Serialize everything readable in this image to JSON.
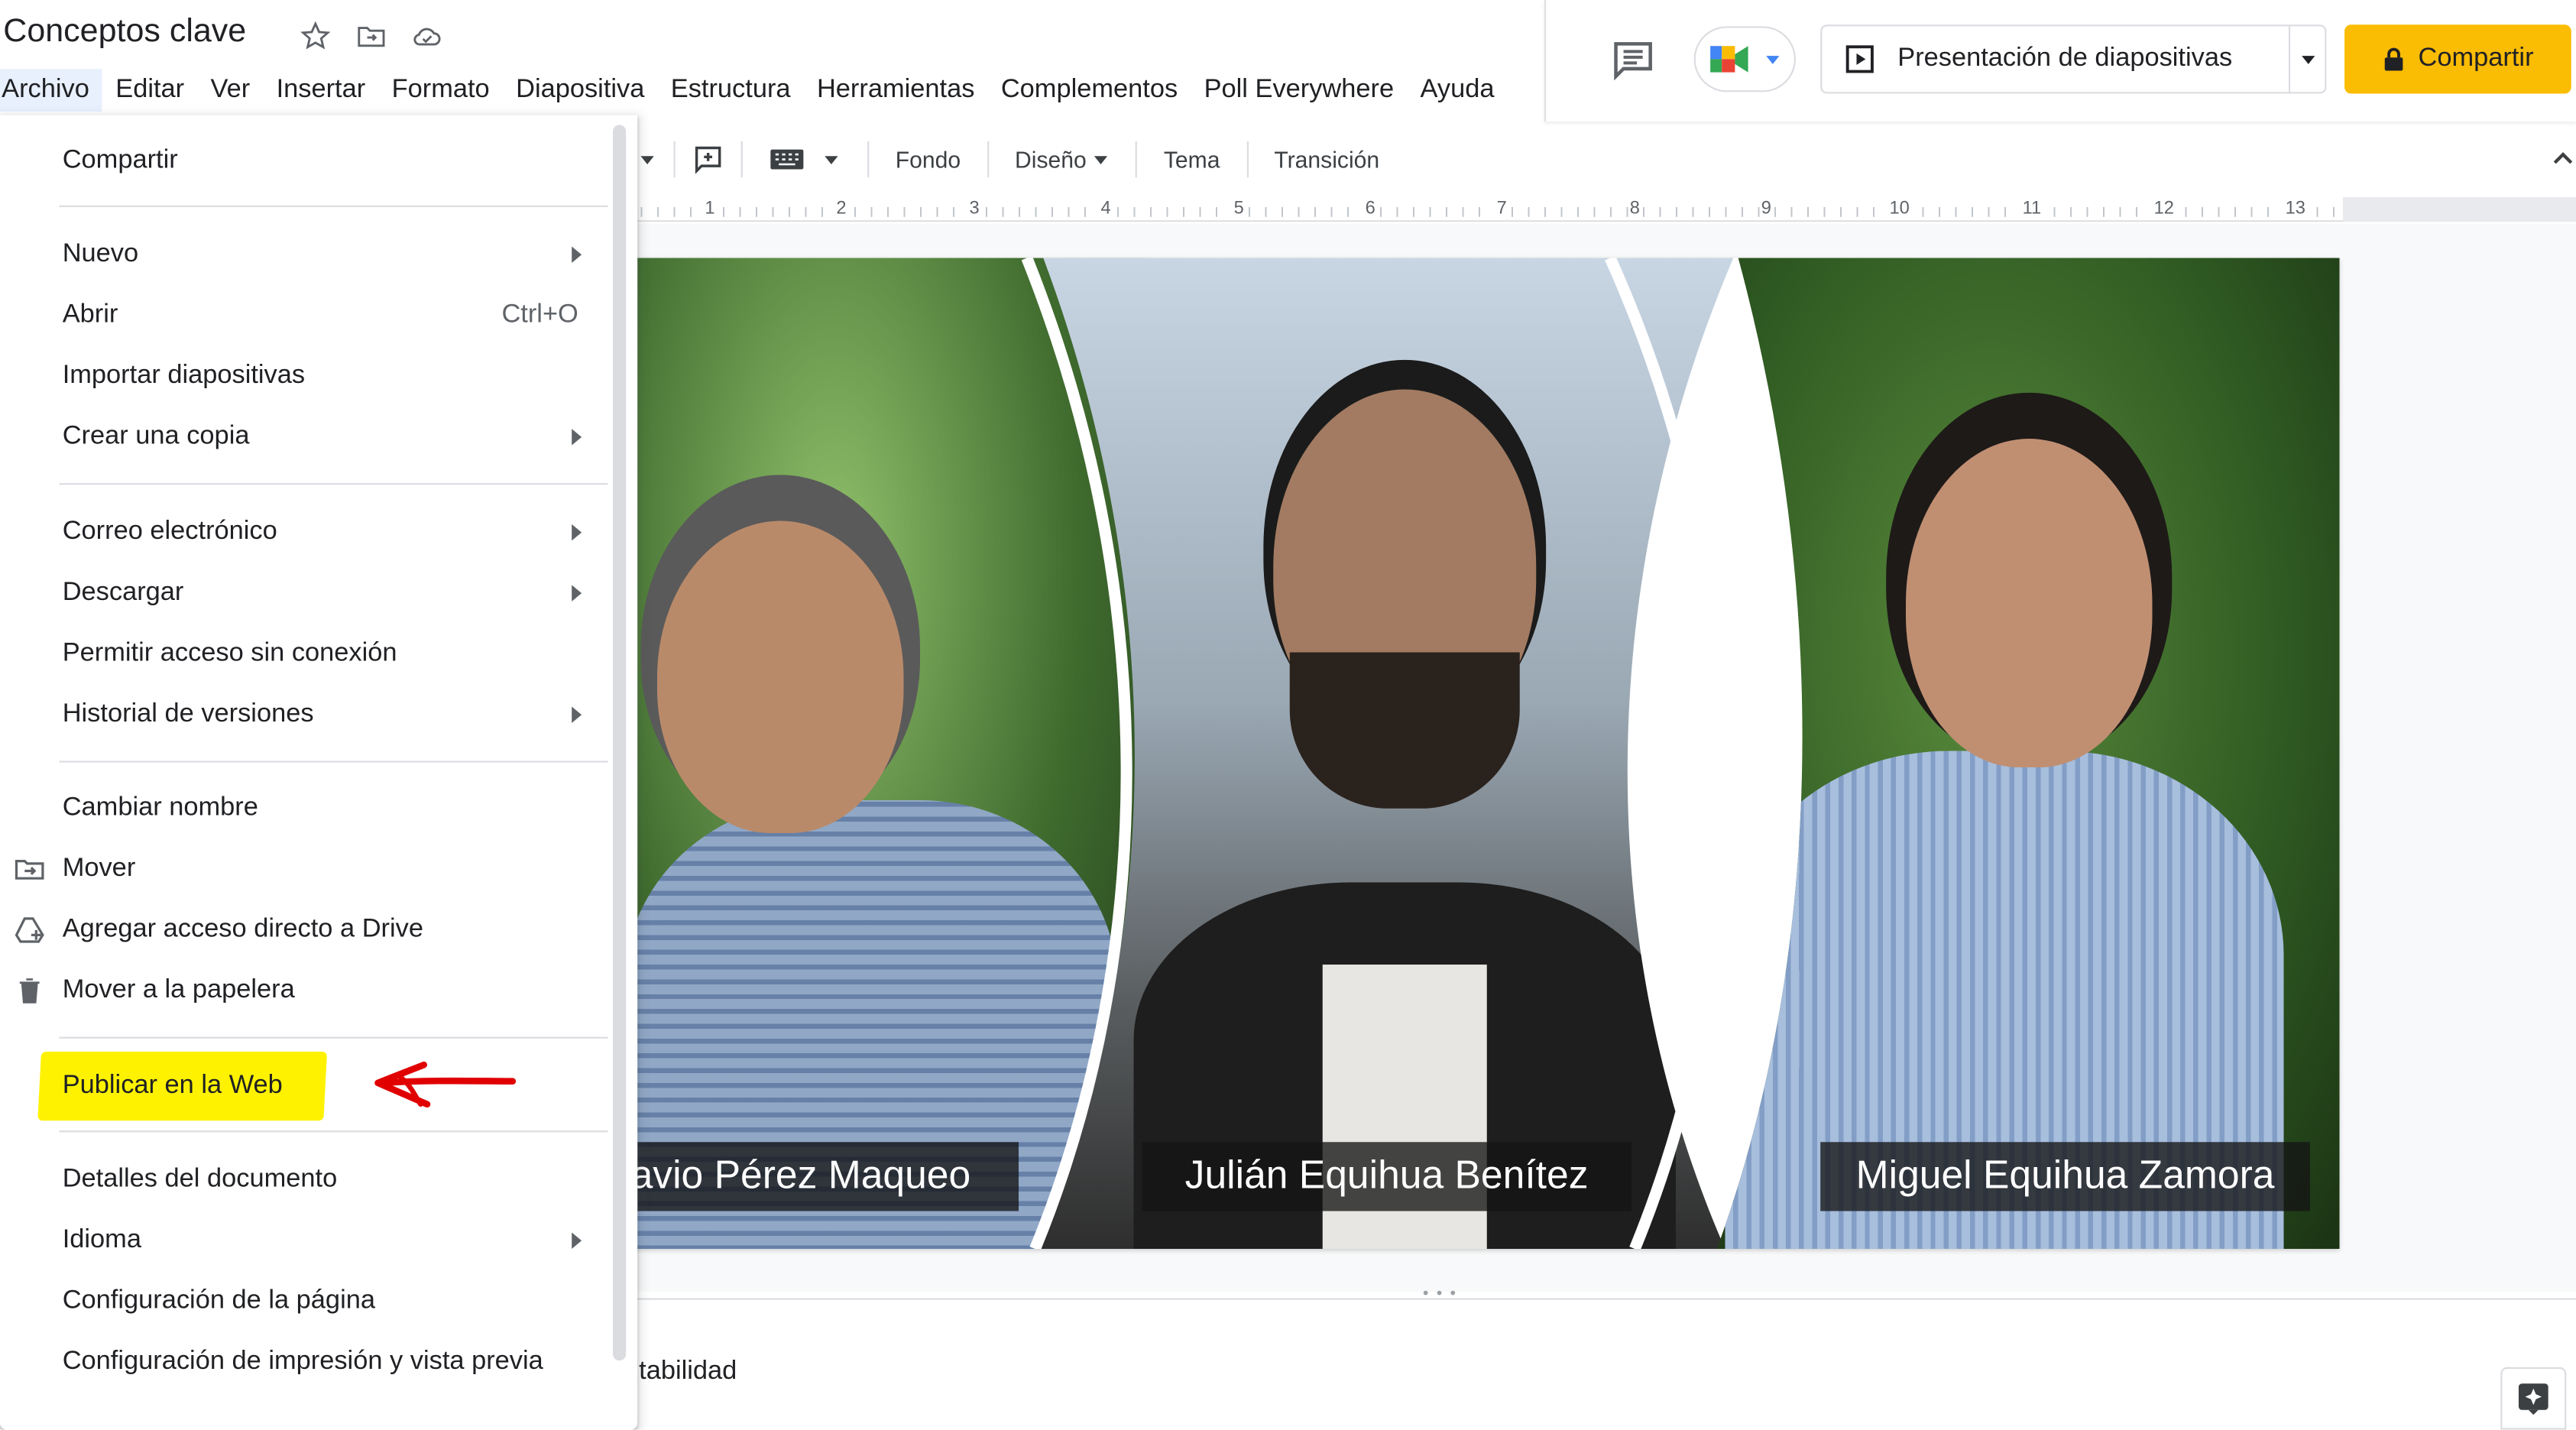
{
  "app": {
    "doc_title": "Conceptos clave",
    "menu": [
      "Archivo",
      "Editar",
      "Ver",
      "Insertar",
      "Formato",
      "Diapositiva",
      "Estructura",
      "Herramientas",
      "Complementos",
      "Poll Everywhere",
      "Ayuda"
    ]
  },
  "header": {
    "present_label": "Presentación de diapositivas",
    "share_label": "Compartir"
  },
  "toolbar": {
    "fondo": "Fondo",
    "diseno": "Diseño",
    "tema": "Tema",
    "transicion": "Transición"
  },
  "ruler": [
    "1",
    "2",
    "3",
    "4",
    "5",
    "6",
    "7",
    "8",
    "9",
    "10",
    "11",
    "12",
    "13"
  ],
  "slide": {
    "captions": [
      "avio Pérez Maqueo",
      "Julián Equihua Benítez",
      "Miguel Equihua Zamora"
    ]
  },
  "notes": {
    "text": "ntabilidad"
  },
  "file_menu": {
    "items": [
      {
        "label": "Compartir"
      },
      {
        "label": "Nuevo"
      },
      {
        "label": "Abrir",
        "shortcut": "Ctrl+O"
      },
      {
        "label": "Importar diapositivas"
      },
      {
        "label": "Crear una copia"
      },
      {
        "label": "Correo electrónico"
      },
      {
        "label": "Descargar"
      },
      {
        "label": "Permitir acceso sin conexión"
      },
      {
        "label": "Historial de versiones"
      },
      {
        "label": "Cambiar nombre"
      },
      {
        "label": "Mover"
      },
      {
        "label": "Agregar acceso directo a Drive"
      },
      {
        "label": "Mover a la papelera"
      },
      {
        "label": "Publicar en la Web"
      },
      {
        "label": "Detalles del documento"
      },
      {
        "label": "Idioma"
      },
      {
        "label": "Configuración de la página"
      },
      {
        "label": "Configuración de impresión y vista previa"
      }
    ]
  },
  "colors": {
    "share": "#fbbc04",
    "highlight": "#fff200",
    "arrow": "#e00000"
  }
}
